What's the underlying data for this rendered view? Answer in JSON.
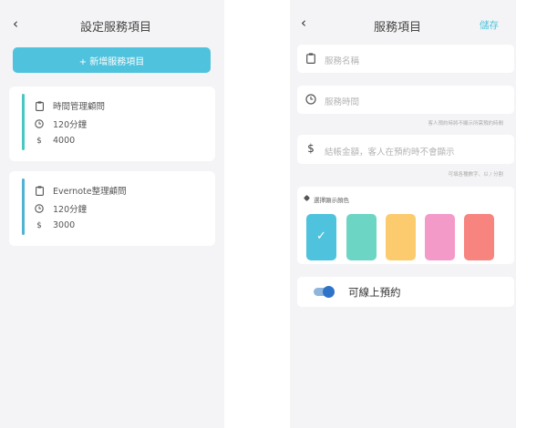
{
  "left_screen": {
    "back_icon": "‹",
    "title": "設定服務項目",
    "add_button_label": "+ 新增服務項目",
    "services": [
      {
        "name": "時間管理顧問",
        "duration": "120分鐘",
        "price": "4000",
        "currency_symbol": "$"
      },
      {
        "name": "Evernote整理顧問",
        "duration": "120分鐘",
        "price": "3000",
        "currency_symbol": "$"
      }
    ]
  },
  "right_screen": {
    "back_icon": "‹",
    "title": "服務項目",
    "save_label": "儲存",
    "name_placeholder": "服務名稱",
    "time_placeholder": "服務時間",
    "time_hint": "客人預約時將不顯示所需預約時間",
    "price_placeholder": "結帳金額，客人在預約時不會顯示",
    "price_hint": "可填各種數字、以 / 分割",
    "currency_symbol": "$",
    "color_label": "選擇顯示顏色",
    "colors": [
      "#4fc3dd",
      "#6dd5c3",
      "#fccb6e",
      "#f49ac9",
      "#f7847e"
    ],
    "selected_color_index": 0,
    "check_glyph": "✓",
    "online_booking_label": "可線上預約",
    "online_booking_enabled": true
  }
}
